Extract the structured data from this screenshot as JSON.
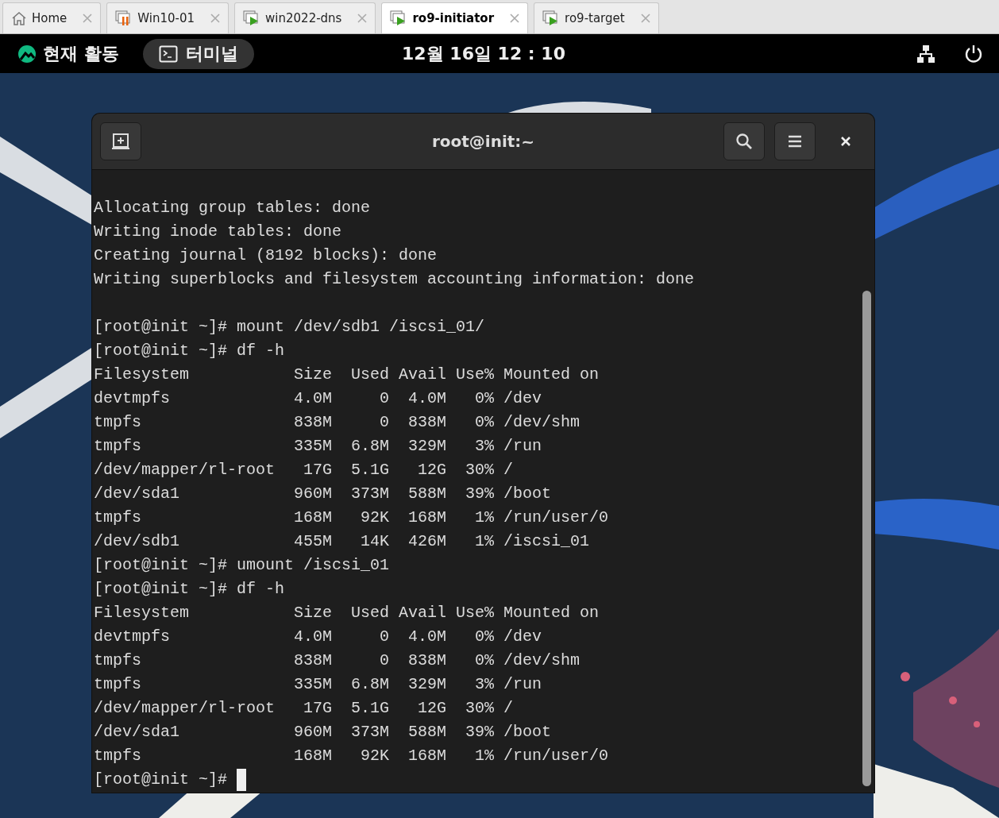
{
  "tabs": [
    {
      "label": "Home",
      "kind": "home",
      "selected": false
    },
    {
      "label": "Win10-01",
      "kind": "suspended",
      "selected": false
    },
    {
      "label": "win2022-dns",
      "kind": "running",
      "selected": false
    },
    {
      "label": "ro9-initiator",
      "kind": "running",
      "selected": true
    },
    {
      "label": "ro9-target",
      "kind": "running",
      "selected": false
    }
  ],
  "top_bar": {
    "activities": "현재 활동",
    "app": "터미널",
    "clock": "12월 16일 12 : 10"
  },
  "terminal": {
    "title": "root@init:~",
    "cursor": true,
    "blocks": [
      {
        "lines": [
          "Allocating group tables: done",
          "Writing inode tables: done",
          "Creating journal (8192 blocks): done",
          "Writing superblocks and filesystem accounting information: done"
        ]
      },
      {
        "lines": [
          "[root@init ~]# mount /dev/sdb1 /iscsi_01/",
          "[root@init ~]# df -h",
          "Filesystem           Size  Used Avail Use% Mounted on",
          "devtmpfs             4.0M     0  4.0M   0% /dev",
          "tmpfs                838M     0  838M   0% /dev/shm",
          "tmpfs                335M  6.8M  329M   3% /run",
          "/dev/mapper/rl-root   17G  5.1G   12G  30% /",
          "/dev/sda1            960M  373M  588M  39% /boot",
          "tmpfs                168M   92K  168M   1% /run/user/0",
          "/dev/sdb1            455M   14K  426M   1% /iscsi_01",
          "[root@init ~]# umount /iscsi_01",
          "[root@init ~]# df -h",
          "Filesystem           Size  Used Avail Use% Mounted on",
          "devtmpfs             4.0M     0  4.0M   0% /dev",
          "tmpfs                838M     0  838M   0% /dev/shm",
          "tmpfs                335M  6.8M  329M   3% /run",
          "/dev/mapper/rl-root   17G  5.1G   12G  30% /",
          "/dev/sda1            960M  373M  588M  39% /boot",
          "tmpfs                168M   92K  168M   1% /run/user/0",
          "[root@init ~]# "
        ]
      }
    ]
  }
}
